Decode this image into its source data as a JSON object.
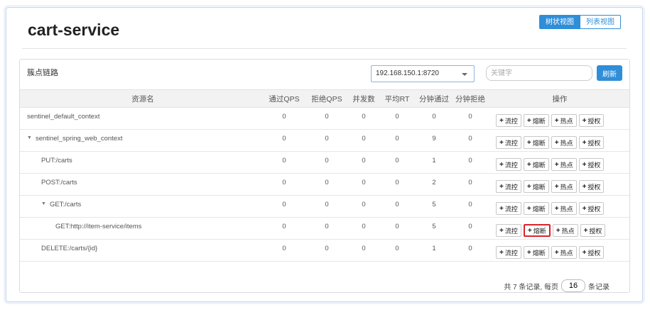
{
  "app": {
    "title": "cart-service"
  },
  "view_toggle": {
    "tree_label": "树状视图",
    "list_label": "列表视图"
  },
  "panel": {
    "title": "簇点链路",
    "machine_select": {
      "value": "192.168.150.1:8720"
    },
    "keyword": {
      "placeholder": "关键字",
      "value": ""
    },
    "refresh_label": "刷新"
  },
  "table": {
    "headers": {
      "name": "资源名",
      "pass_qps": "通过QPS",
      "block_qps": "拒绝QPS",
      "concurrency": "并发数",
      "avg_rt": "平均RT",
      "min_pass": "分钟通过",
      "min_block": "分钟拒绝",
      "ops": "操作"
    },
    "op_labels": {
      "flow": "流控",
      "degrade": "熔断",
      "hot": "热点",
      "auth": "授权"
    },
    "rows": [
      {
        "name": "sentinel_default_context",
        "depth": 0,
        "expandable": false,
        "pass_qps": "0",
        "block_qps": "0",
        "concurrency": "0",
        "avg_rt": "0",
        "min_pass": "0",
        "min_block": "0"
      },
      {
        "name": "sentinel_spring_web_context",
        "depth": 0,
        "expandable": true,
        "toggle": "▼",
        "pass_qps": "0",
        "block_qps": "0",
        "concurrency": "0",
        "avg_rt": "0",
        "min_pass": "9",
        "min_block": "0"
      },
      {
        "name": "PUT:/carts",
        "depth": 1,
        "expandable": false,
        "pass_qps": "0",
        "block_qps": "0",
        "concurrency": "0",
        "avg_rt": "0",
        "min_pass": "1",
        "min_block": "0"
      },
      {
        "name": "POST:/carts",
        "depth": 1,
        "expandable": false,
        "pass_qps": "0",
        "block_qps": "0",
        "concurrency": "0",
        "avg_rt": "0",
        "min_pass": "2",
        "min_block": "0"
      },
      {
        "name": "GET:/carts",
        "depth": 1,
        "expandable": true,
        "toggle": "▼",
        "pass_qps": "0",
        "block_qps": "0",
        "concurrency": "0",
        "avg_rt": "0",
        "min_pass": "5",
        "min_block": "0"
      },
      {
        "name": "GET:http://item-service/items",
        "depth": 2,
        "expandable": false,
        "highlight_op": "degrade",
        "pass_qps": "0",
        "block_qps": "0",
        "concurrency": "0",
        "avg_rt": "0",
        "min_pass": "5",
        "min_block": "0"
      },
      {
        "name": "DELETE:/carts/{id}",
        "depth": 1,
        "expandable": false,
        "pass_qps": "0",
        "block_qps": "0",
        "concurrency": "0",
        "avg_rt": "0",
        "min_pass": "1",
        "min_block": "0"
      }
    ]
  },
  "pagination": {
    "summary_prefix": "共 7 条记录, 每页",
    "page_size": "16",
    "summary_suffix": "条记录"
  },
  "colors": {
    "accent": "#2f8ed8",
    "highlight_border": "#d9232d"
  }
}
